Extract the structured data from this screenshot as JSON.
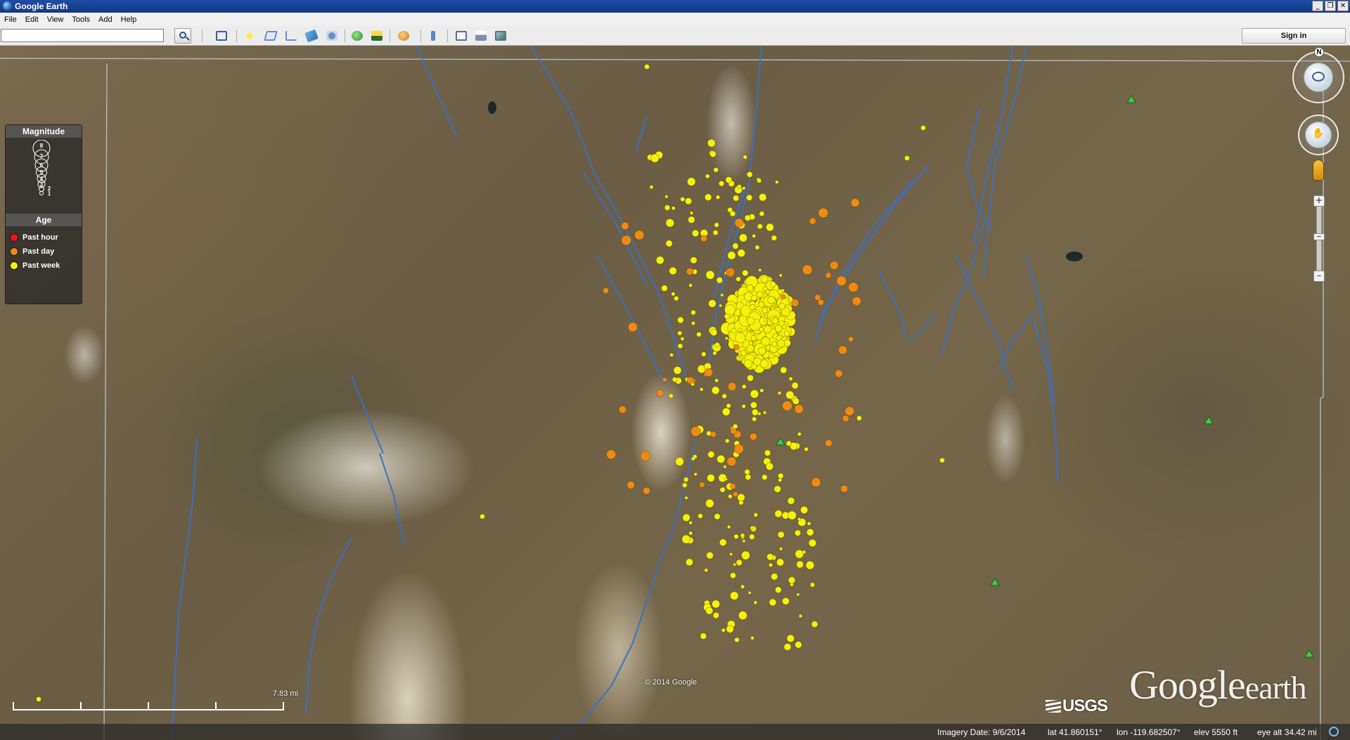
{
  "window": {
    "title": "Google Earth",
    "controls": [
      "minimize",
      "restore",
      "close"
    ]
  },
  "menu": [
    "File",
    "Edit",
    "View",
    "Tools",
    "Add",
    "Help"
  ],
  "toolbar": {
    "search_value": "",
    "sign_in_label": "Sign in",
    "icons": [
      "sidebar-icon",
      "placemark-icon",
      "polygon-icon",
      "path-icon",
      "image-overlay-icon",
      "record-tour-icon",
      "historical-imagery-icon",
      "sunlight-icon",
      "planets-icon",
      "ruler-icon",
      "email-icon",
      "print-icon",
      "save-image-icon"
    ]
  },
  "legend": {
    "magnitude_title": "Magnitude",
    "magnitude_scale": [
      "8",
      "7",
      "6",
      "5",
      "4",
      "3",
      "2",
      "1"
    ],
    "age_title": "Age",
    "age_items": [
      {
        "label": "Past hour",
        "color": "#e8191a"
      },
      {
        "label": "Past day",
        "color": "#f08a12"
      },
      {
        "label": "Past week",
        "color": "#f5f20a"
      }
    ]
  },
  "navigation": {
    "north_label": "N"
  },
  "map": {
    "copyright": "© 2014 Google",
    "watermark_google": "Google",
    "watermark_earth": "earth",
    "usgs_logo": "USGS",
    "scale_label": "7.83 mi"
  },
  "status": {
    "imagery_date": "Imagery Date: 9/6/2014",
    "lat": "lat   41.860151°",
    "lon": "lon -119.682507°",
    "elev": "elev  5550 ft",
    "eye_alt": "eye alt  34.42 mi"
  },
  "colors": {
    "fault_line": "#3d6fc7",
    "past_day": "#f08a12",
    "past_week": "#f5f20a",
    "boundary": "#b8c4d8",
    "triangle": "#46c84a"
  }
}
